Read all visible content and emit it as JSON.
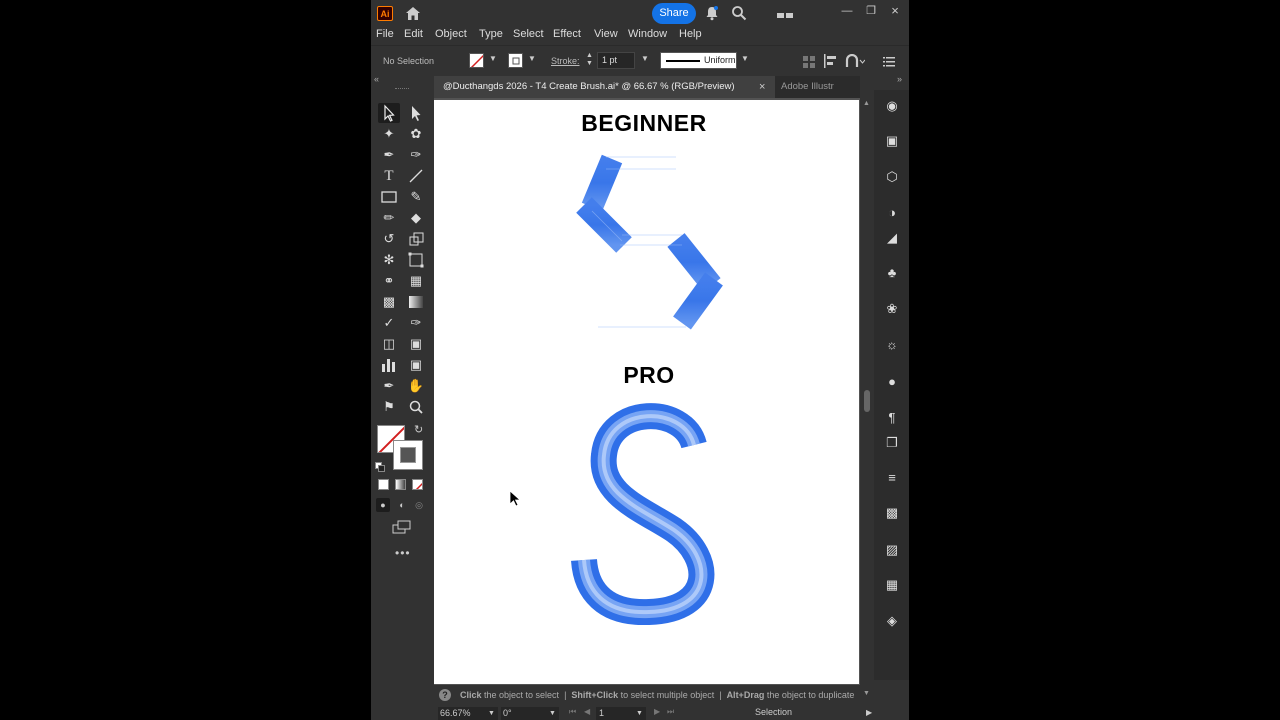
{
  "app": {
    "logo": "Ai",
    "share_label": "Share"
  },
  "menu": {
    "items": [
      "File",
      "Edit",
      "Object",
      "Type",
      "Select",
      "Effect",
      "View",
      "Window",
      "Help"
    ]
  },
  "control": {
    "selection": "No Selection",
    "stroke_label": "Stroke:",
    "stroke_value": "1 pt",
    "profile": "Uniform"
  },
  "tabs": {
    "active": "@Ducthangds 2026 - T4 Create Brush.ai* @ 66.67 % (RGB/Preview)",
    "close": "×",
    "inactive": "Adobe Illustr"
  },
  "canvas": {
    "heading_top": "BEGINNER",
    "heading_bottom": "PRO",
    "accent_color": "#2f6fe8"
  },
  "status": {
    "hint": [
      {
        "bold": "Click",
        "text": " the object to select"
      },
      {
        "bold": "Shift+Click",
        "text": " to select multiple object"
      },
      {
        "bold": "Alt+Drag",
        "text": " the object to duplicate"
      }
    ]
  },
  "bottom": {
    "zoom": "66.67%",
    "rotation": "0°",
    "artboard": "1",
    "tool": "Selection"
  }
}
